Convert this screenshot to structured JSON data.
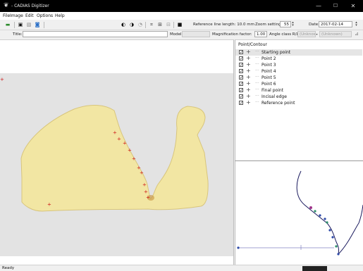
{
  "window": {
    "title": "- CADIAS Digitizer",
    "minimize_glyph": "—",
    "maximize_glyph": "☐",
    "close_glyph": "✕"
  },
  "menu": [
    "File",
    "Image",
    "Edit",
    "Options",
    "Help"
  ],
  "toolbar": {
    "icons": [
      "save-icon",
      "open-folder-icon",
      "image-icon",
      "image-select-icon",
      "zoom-in-icon",
      "zoom-out-icon",
      "zoom-reset-icon",
      "grid-icon",
      "grid-add-icon",
      "grid-remove-icon",
      "contour-icon"
    ],
    "reference_line_length": "Reference line length: 10.0 mm",
    "zoom_label": "Zoom settings:",
    "zoom_value": "55",
    "date_label": "Date:",
    "date_value": "2017-02-14"
  },
  "fields": {
    "title_label": "Title:",
    "title_value": "",
    "model_label": "Model:",
    "model_value": "",
    "magnification_label": "Magnification factor:",
    "magnification_value": "1.00",
    "angle_label": "Angle class R/L:",
    "angle_right": "(Unknown)",
    "angle_left": "(Unknown)"
  },
  "tree": {
    "header": "Point/Contour",
    "items": [
      {
        "label": "Starting point",
        "checked": true,
        "selected": true
      },
      {
        "label": "Point 2",
        "checked": true,
        "selected": false
      },
      {
        "label": "Point 3",
        "checked": true,
        "selected": false
      },
      {
        "label": "Point 4",
        "checked": true,
        "selected": false
      },
      {
        "label": "Point 5",
        "checked": true,
        "selected": false
      },
      {
        "label": "Point 6",
        "checked": true,
        "selected": false
      },
      {
        "label": "Final point",
        "checked": true,
        "selected": false
      },
      {
        "label": "Incisal edge",
        "checked": true,
        "selected": false
      },
      {
        "label": "Reference point",
        "checked": true,
        "selected": false
      }
    ]
  },
  "status": {
    "text": "Ready"
  },
  "colors": {
    "titlebar": "#000000",
    "model_fill": "#f2e6a3",
    "marker": "#cc1111",
    "contour_line": "#1a1a5e",
    "contour_dot": "#2d4aa8"
  }
}
